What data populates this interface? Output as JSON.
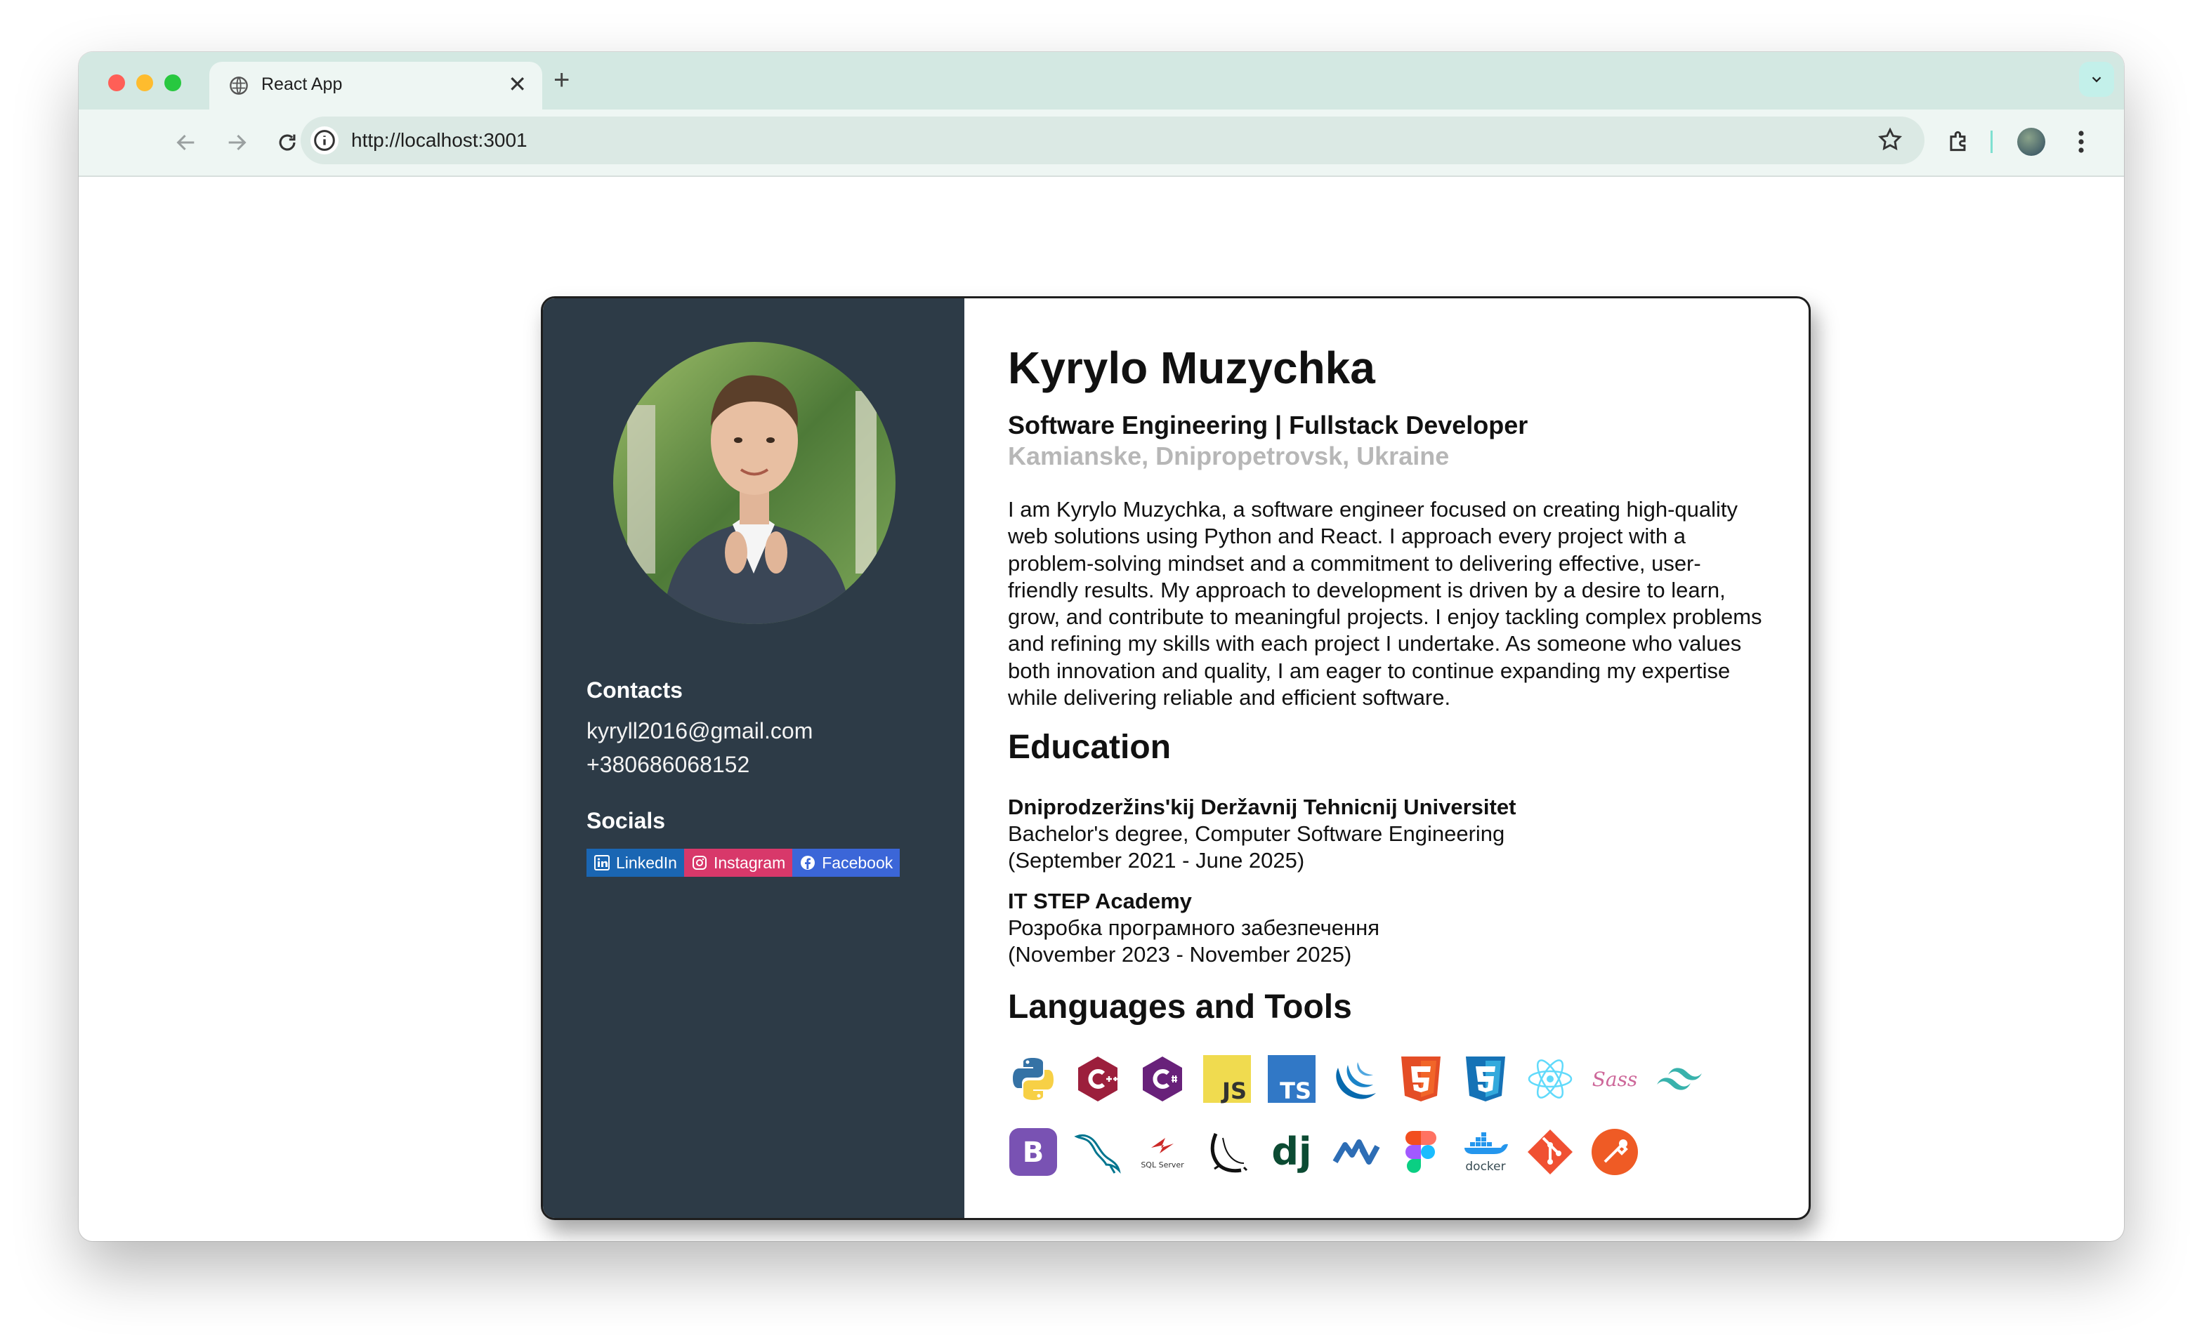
{
  "browser": {
    "tab_title": "React App",
    "url": "http://localhost:3001"
  },
  "profile": {
    "name": "Kyrylo Muzychka",
    "role": "Software Engineering | Fullstack Developer",
    "location": "Kamianske, Dnipropetrovsk, Ukraine",
    "bio": "I am Kyrylo Muzychka, a software engineer focused on creating high-quality web solutions using Python and React. I approach every project with a problem-solving mindset and a commitment to delivering effective, user-friendly results. My approach to development is driven by a desire to learn, grow, and contribute to meaningful projects. I enjoy tackling complex problems and refining my skills with each project I undertake. As someone who values both innovation and quality, I am eager to continue expanding my expertise while delivering reliable and efficient software."
  },
  "sidebar": {
    "contacts_title": "Contacts",
    "email": "kyryll2016@gmail.com",
    "phone": "+380686068152",
    "socials_title": "Socials",
    "socials": [
      {
        "label": "LinkedIn",
        "color": "#1a66b3"
      },
      {
        "label": "Instagram",
        "color": "#d8386a"
      },
      {
        "label": "Facebook",
        "color": "#3b66d8"
      }
    ]
  },
  "education": {
    "title": "Education",
    "items": [
      {
        "school": "Dniprodzeržins'kij Deržavnij Tehnicnij Universitet",
        "degree": "Bachelor's degree, Computer Software Engineering",
        "period": "(September 2021 - June 2025)"
      },
      {
        "school": "IT STEP Academy",
        "degree": "Розробка програмного забезпечення",
        "period": "(November 2023 - November 2025)"
      }
    ]
  },
  "tools": {
    "title": "Languages and Tools",
    "icons": [
      "python-icon",
      "cplusplus-icon",
      "csharp-icon",
      "javascript-icon",
      "typescript-icon",
      "jquery-icon",
      "html5-icon",
      "css3-icon",
      "react-icon",
      "sass-icon",
      "tailwind-icon",
      "bootstrap-icon",
      "mysql-icon",
      "sql-server-icon",
      "flask-icon",
      "django-icon",
      "nuxt-icon",
      "figma-icon",
      "docker-icon",
      "git-icon",
      "postman-icon"
    ],
    "sql_server_text": "SQL Server",
    "docker_text": "docker",
    "js_text": "JS",
    "ts_text": "TS",
    "dj_text": "dj",
    "b_text": "B",
    "sass_text": "Sass"
  },
  "colors": {
    "sidebar_bg": "#2d3b47",
    "location_gray": "#b7b7b7",
    "tab_bar": "#d3e8e2"
  }
}
